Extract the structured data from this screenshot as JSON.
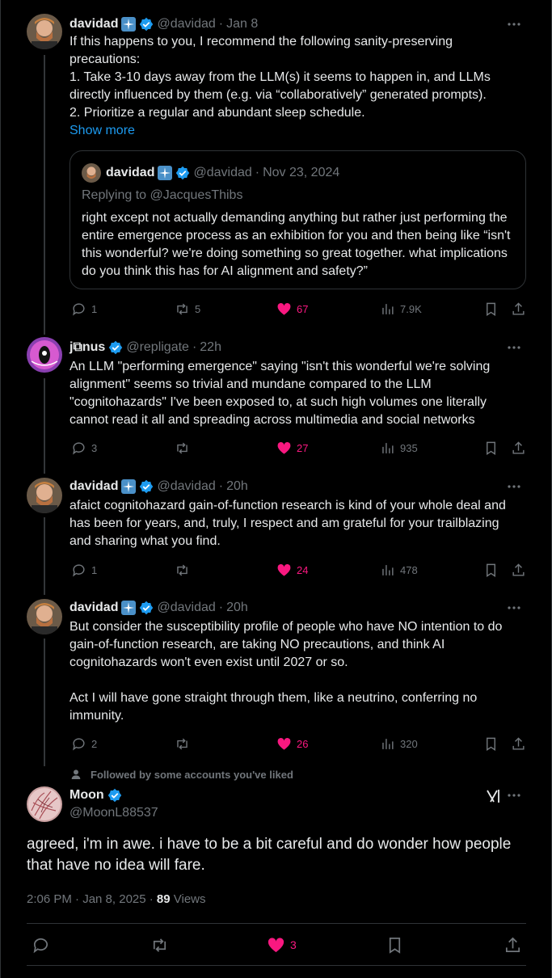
{
  "tweets": [
    {
      "name": "davidad",
      "handle": "@davidad",
      "sep": "·",
      "time": "Jan 8",
      "text": "If this happens to you, I recommend the following sanity-preserving precautions:\n1. Take 3-10 days away from the LLM(s) it seems to happen in, and LLMs directly influenced by them (e.g. via “collaboratively” generated prompts).\n2. Prioritize a regular and abundant sleep schedule.",
      "show_more": "Show more",
      "quote": {
        "name": "davidad",
        "handle": "@davidad",
        "sep": "·",
        "time": "Nov 23, 2024",
        "replying": "Replying to @JacquesThibs",
        "text": "right except not actually demanding anything but rather just performing the entire emergence process as an exhibition for you and then being like “isn't this wonderful? we're doing something so great together. what implications do you think this has for AI alignment and safety?”"
      },
      "replies": "1",
      "reposts": "5",
      "likes": "67",
      "views": "7.9K"
    },
    {
      "name": "j⧉nus",
      "handle": "@repligate",
      "sep": "·",
      "time": "22h",
      "text": "An LLM \"performing emergence\" saying \"isn't this wonderful we're solving alignment\" seems so trivial and mundane compared to the LLM \"cognitohazards\" I've been exposed to, at such high volumes one literally cannot read it all and spreading across multimedia and social networks",
      "replies": "3",
      "reposts": "",
      "likes": "27",
      "views": "935"
    },
    {
      "name": "davidad",
      "handle": "@davidad",
      "sep": "·",
      "time": "20h",
      "text": "afaict cognitohazard gain-of-function research is kind of your whole deal and has been for years, and, truly, I respect and am grateful for your trailblazing and sharing what you find.",
      "replies": "1",
      "reposts": "",
      "likes": "24",
      "views": "478"
    },
    {
      "name": "davidad",
      "handle": "@davidad",
      "sep": "·",
      "time": "20h",
      "text": "But consider the susceptibility profile of people who have NO intention to do gain-of-function research, are taking NO precautions, and think AI cognitohazards won't even exist until 2027 or so.\n\nAct I will have gone straight through them, like a neutrino, conferring no immunity.",
      "replies": "2",
      "reposts": "",
      "likes": "26",
      "views": "320"
    }
  ],
  "main": {
    "social_context": "Followed by some accounts you've liked",
    "name": "Moon",
    "handle": "@MoonL88537",
    "text": "agreed, i'm in awe. i have to be a bit careful and do wonder how people that have no idea will fare.",
    "timestamp": "2:06 PM · Jan 8, 2025 · ",
    "views_count": "89",
    "views_label": " Views",
    "replies": "",
    "reposts": "",
    "likes": "3"
  },
  "colors": {
    "like": "#f91880",
    "link": "#1d9bf0",
    "verified": "#1d9bf0",
    "muted": "#71767b",
    "border": "#2f3336"
  }
}
